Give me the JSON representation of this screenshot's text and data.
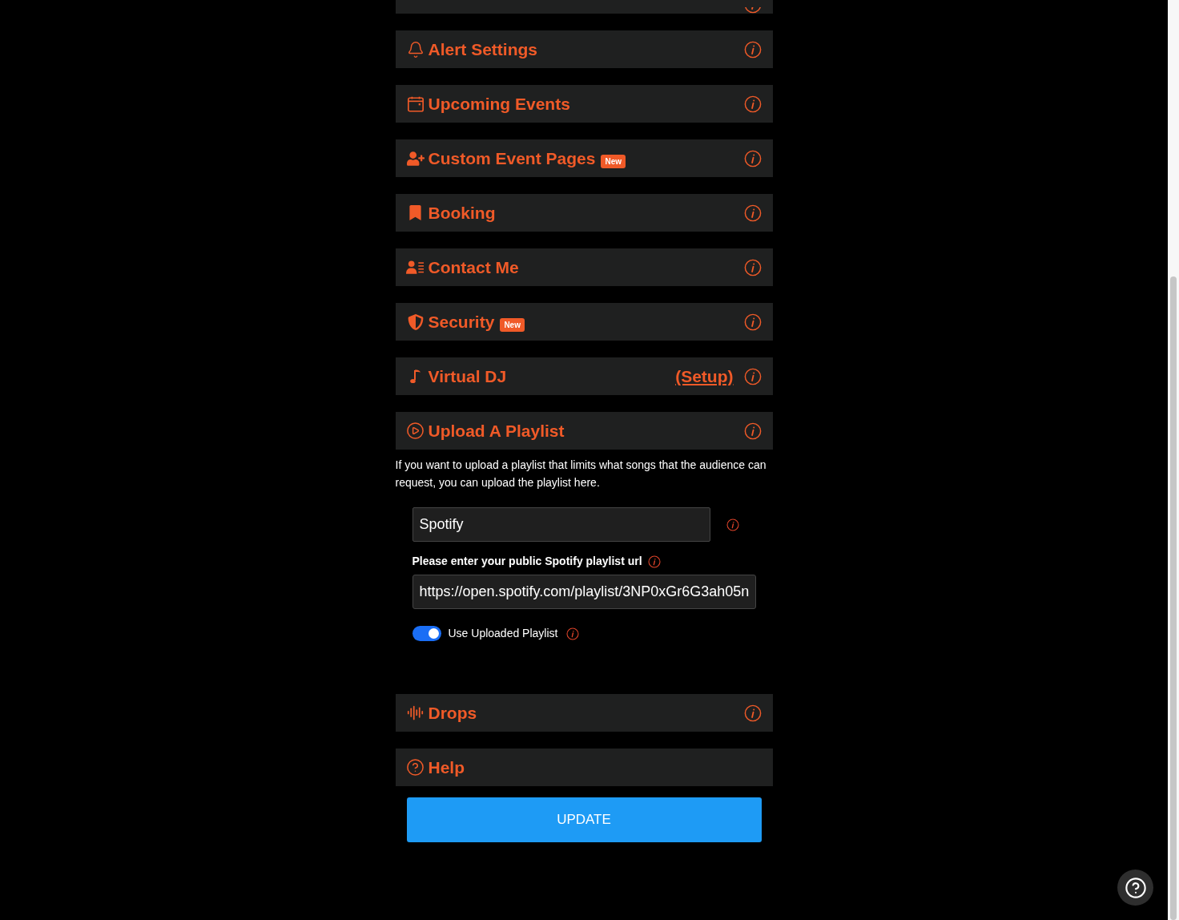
{
  "sections": [
    {
      "has_info": true
    },
    {
      "title": "Alert Settings",
      "has_info": true
    },
    {
      "title": "Upcoming Events",
      "has_info": true
    },
    {
      "title": "Custom Event Pages",
      "badge": "New",
      "has_info": true
    },
    {
      "title": "Booking",
      "has_info": true
    },
    {
      "title": "Contact Me",
      "has_info": true
    },
    {
      "title": "Security",
      "badge": "New",
      "has_info": true
    },
    {
      "title": "Virtual DJ",
      "setup_link": "(Setup)",
      "has_info": true
    },
    {
      "title": "Upload A Playlist",
      "has_info": true,
      "content": {
        "description": "If you want to upload a playlist that limits what songs that the audience can request, you can upload the playlist here.",
        "source": "Spotify",
        "url_label": "Please enter your public Spotify playlist url",
        "url": "https://open.spotify.com/playlist/3NP0xGr6G3ah05n",
        "toggle": {
          "label": "Use Uploaded Playlist",
          "on": true
        }
      }
    },
    {
      "title": "Drops",
      "has_info": true
    },
    {
      "title": "Help",
      "has_info": false
    }
  ],
  "update_button": "UPDATE"
}
